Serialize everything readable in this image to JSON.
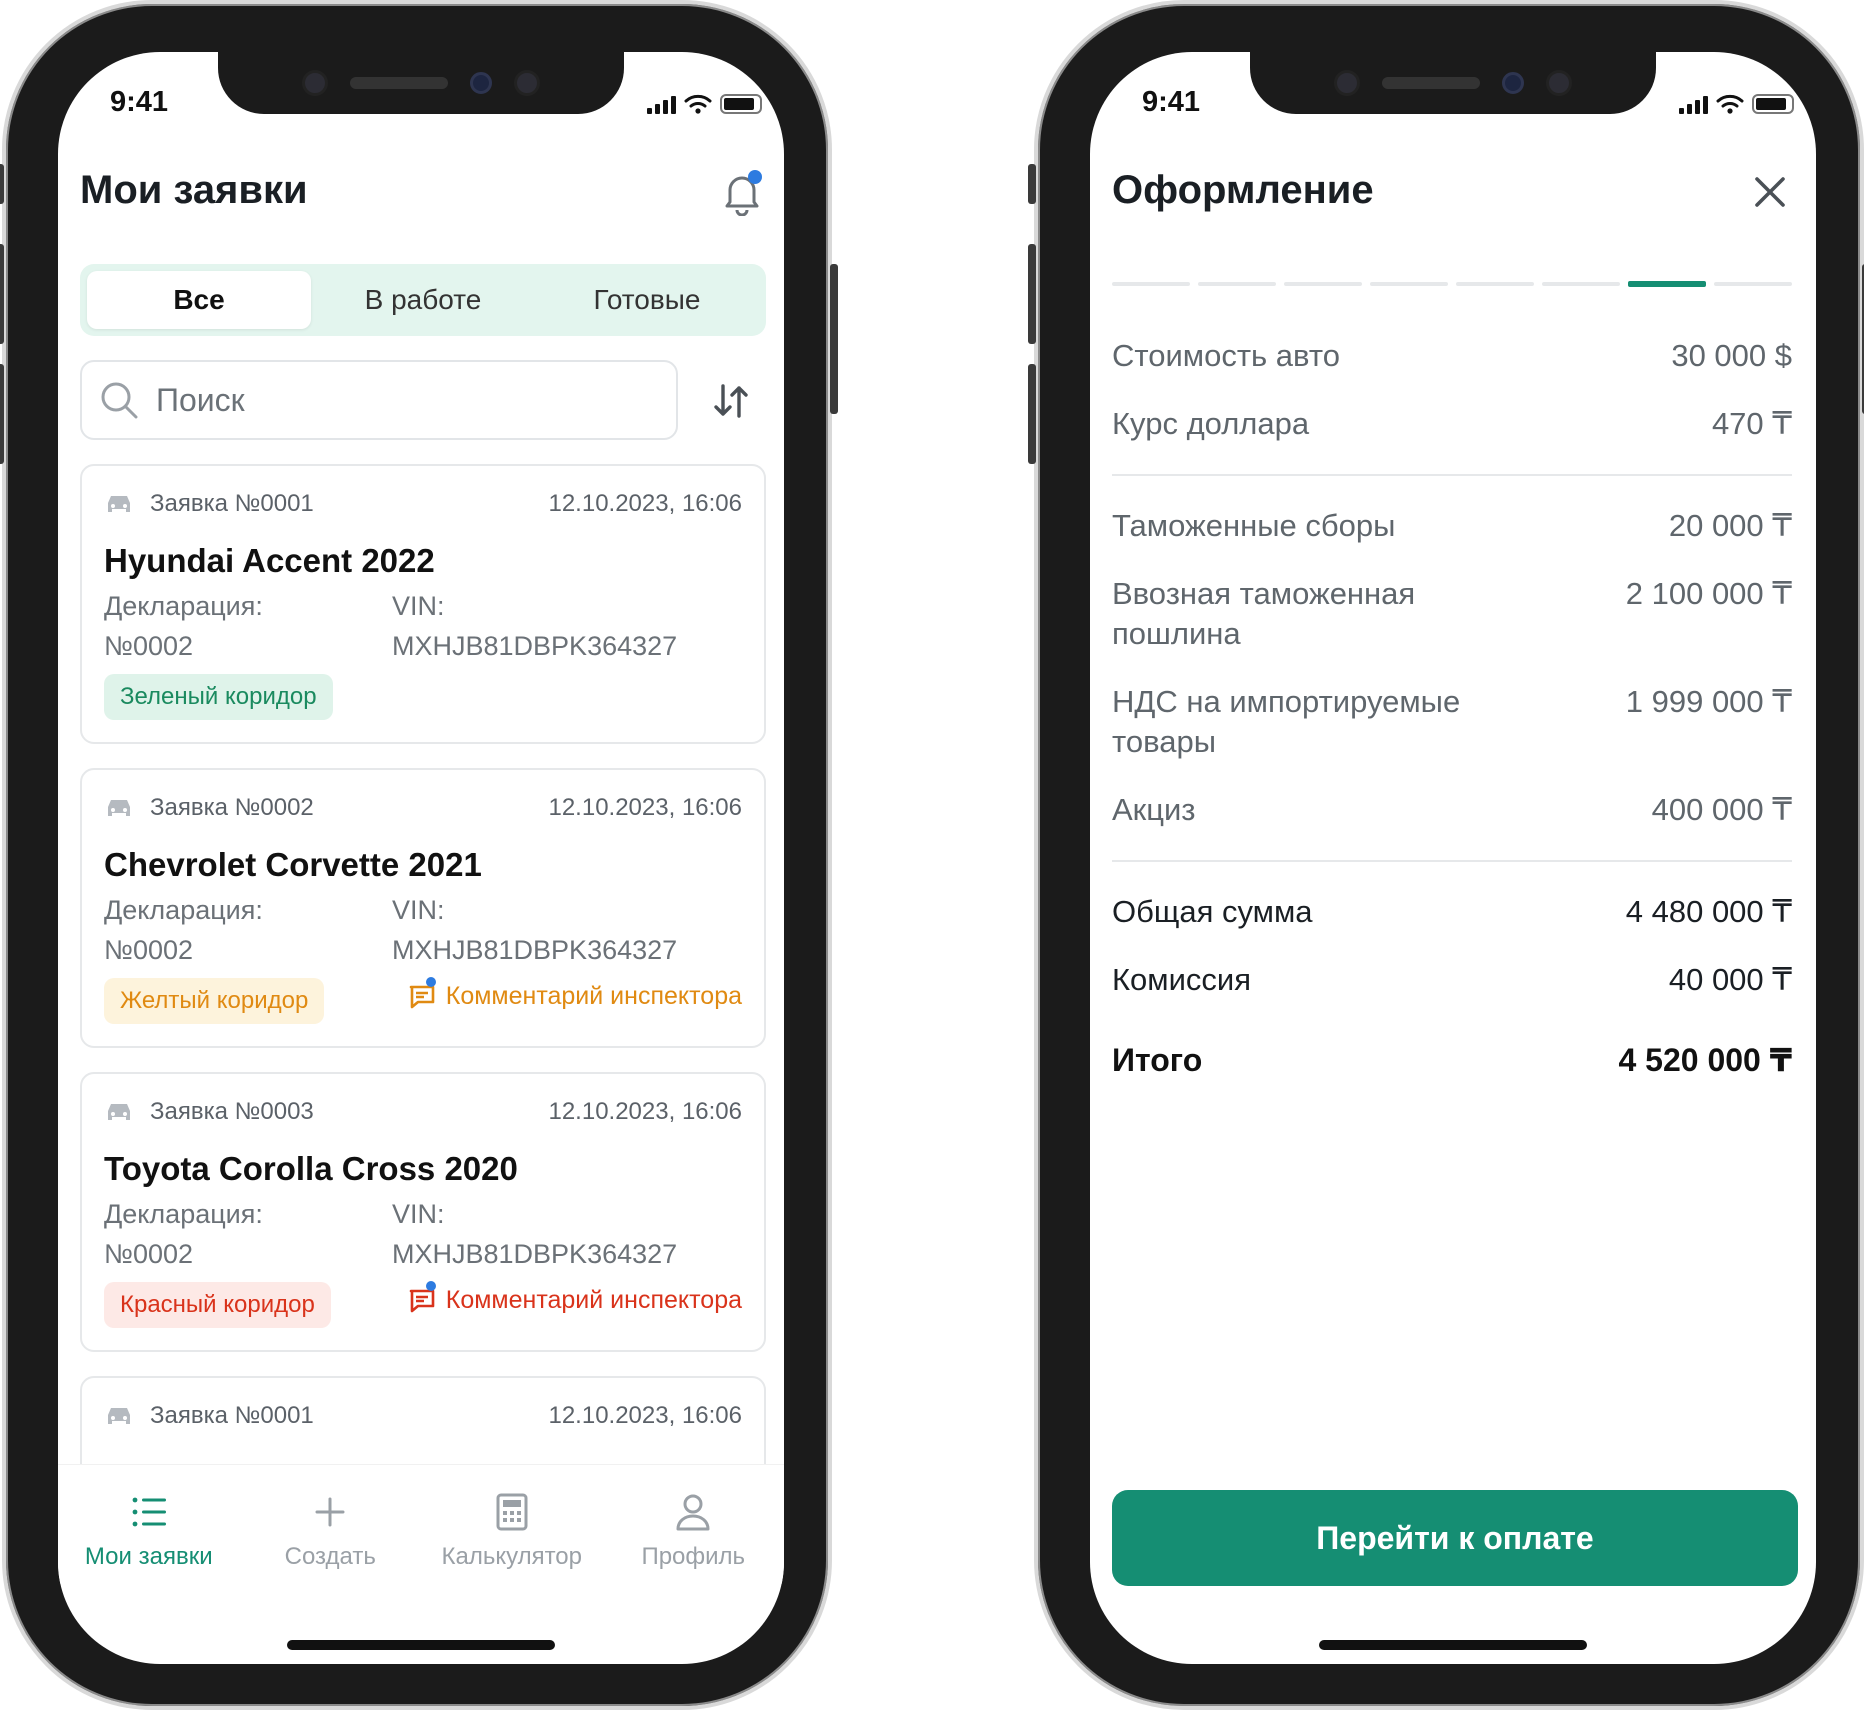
{
  "status_bar": {
    "time": "9:41"
  },
  "orders_screen": {
    "title": "Мои заявки",
    "tabs": [
      "Все",
      "В работе",
      "Готовые"
    ],
    "search_placeholder": "Поиск",
    "cards": [
      {
        "number": "Заявка №0001",
        "date": "12.10.2023, 16:06",
        "title": "Hyundai Accent 2022",
        "decl_label": "Декларация:",
        "decl_value": "№0002",
        "vin_label": "VIN:",
        "vin_value": "MXHJB81DBPK364327",
        "tag": "Зеленый коридор",
        "tag_color": "green",
        "comment": ""
      },
      {
        "number": "Заявка №0002",
        "date": "12.10.2023, 16:06",
        "title": "Chevrolet Corvette 2021",
        "decl_label": "Декларация:",
        "decl_value": "№0002",
        "vin_label": "VIN:",
        "vin_value": "MXHJB81DBPK364327",
        "tag": "Желтый коридор",
        "tag_color": "yellow",
        "comment": "Комментарий инспектора",
        "comment_color": "#e08a12"
      },
      {
        "number": "Заявка №0003",
        "date": "12.10.2023, 16:06",
        "title": "Toyota Corolla Cross 2020",
        "decl_label": "Декларация:",
        "decl_value": "№0002",
        "vin_label": "VIN:",
        "vin_value": "MXHJB81DBPK364327",
        "tag": "Красный коридор",
        "tag_color": "red",
        "comment": "Комментарий инспектора",
        "comment_color": "#d9331b"
      },
      {
        "number": "Заявка №0001",
        "date": "12.10.2023, 16:06",
        "title": "",
        "decl_label": "",
        "decl_value": "",
        "vin_label": "",
        "vin_value": "",
        "tag": "",
        "tag_color": "",
        "comment": ""
      }
    ],
    "tabbar": [
      {
        "label": "Мои заявки",
        "icon": "list-icon",
        "active": true
      },
      {
        "label": "Создать",
        "icon": "plus-icon",
        "active": false
      },
      {
        "label": "Калькулятор",
        "icon": "calculator-icon",
        "active": false
      },
      {
        "label": "Профиль",
        "icon": "profile-icon",
        "active": false
      }
    ]
  },
  "checkout_screen": {
    "title": "Оформление",
    "steps_total": 8,
    "step_current": 7,
    "rows_group1": [
      {
        "label": "Стоимость авто",
        "value": "30 000 $"
      },
      {
        "label": "Курс доллара",
        "value": "470 ₸"
      }
    ],
    "rows_group2": [
      {
        "label": "Таможенные сборы",
        "value": "20 000 ₸"
      },
      {
        "label": "Ввозная таможенная пошлина",
        "value": "2 100 000 ₸"
      },
      {
        "label": "НДС на импортируемые товары",
        "value": "1 999 000 ₸"
      },
      {
        "label": "Акциз",
        "value": "400 000 ₸"
      }
    ],
    "rows_group3": [
      {
        "label": "Общая сумма",
        "value": "4 480 000 ₸"
      },
      {
        "label": "Комиссия",
        "value": "40 000 ₸"
      }
    ],
    "total": {
      "label": "Итого",
      "value": "4 520 000 ₸"
    },
    "pay_button": "Перейти к оплате"
  },
  "colors": {
    "accent": "#158e73",
    "notification_dot": "#2d7be0"
  }
}
